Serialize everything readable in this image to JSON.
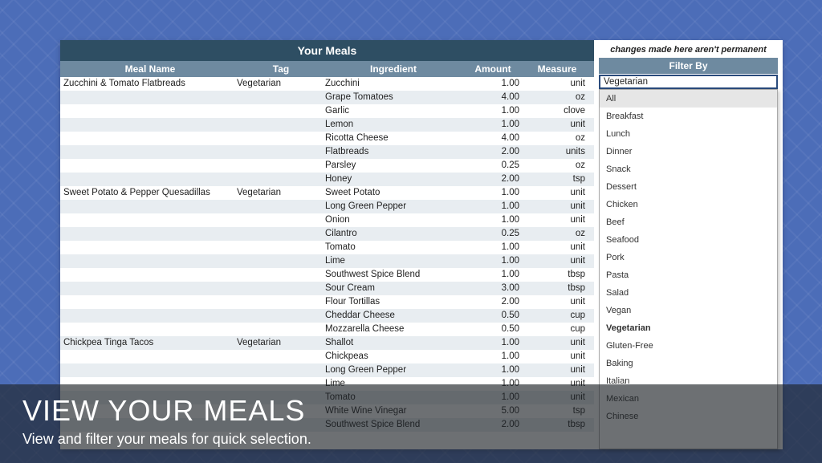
{
  "title": "Your Meals",
  "columns": {
    "meal": "Meal Name",
    "tag": "Tag",
    "ingredient": "Ingredient",
    "amount": "Amount",
    "measure": "Measure"
  },
  "rows": [
    {
      "meal": "Zucchini & Tomato Flatbreads",
      "tag": "Vegetarian",
      "ingredient": "Zucchini",
      "amount": "1.00",
      "measure": "unit"
    },
    {
      "meal": "",
      "tag": "",
      "ingredient": "Grape Tomatoes",
      "amount": "4.00",
      "measure": "oz"
    },
    {
      "meal": "",
      "tag": "",
      "ingredient": "Garlic",
      "amount": "1.00",
      "measure": "clove"
    },
    {
      "meal": "",
      "tag": "",
      "ingredient": "Lemon",
      "amount": "1.00",
      "measure": "unit"
    },
    {
      "meal": "",
      "tag": "",
      "ingredient": "Ricotta Cheese",
      "amount": "4.00",
      "measure": "oz"
    },
    {
      "meal": "",
      "tag": "",
      "ingredient": "Flatbreads",
      "amount": "2.00",
      "measure": "units"
    },
    {
      "meal": "",
      "tag": "",
      "ingredient": "Parsley",
      "amount": "0.25",
      "measure": "oz"
    },
    {
      "meal": "",
      "tag": "",
      "ingredient": "Honey",
      "amount": "2.00",
      "measure": "tsp"
    },
    {
      "meal": "Sweet Potato & Pepper Quesadillas",
      "tag": "Vegetarian",
      "ingredient": "Sweet Potato",
      "amount": "1.00",
      "measure": "unit"
    },
    {
      "meal": "",
      "tag": "",
      "ingredient": "Long Green Pepper",
      "amount": "1.00",
      "measure": "unit"
    },
    {
      "meal": "",
      "tag": "",
      "ingredient": "Onion",
      "amount": "1.00",
      "measure": "unit"
    },
    {
      "meal": "",
      "tag": "",
      "ingredient": "Cilantro",
      "amount": "0.25",
      "measure": "oz"
    },
    {
      "meal": "",
      "tag": "",
      "ingredient": "Tomato",
      "amount": "1.00",
      "measure": "unit"
    },
    {
      "meal": "",
      "tag": "",
      "ingredient": "Lime",
      "amount": "1.00",
      "measure": "unit"
    },
    {
      "meal": "",
      "tag": "",
      "ingredient": "Southwest Spice Blend",
      "amount": "1.00",
      "measure": "tbsp"
    },
    {
      "meal": "",
      "tag": "",
      "ingredient": "Sour Cream",
      "amount": "3.00",
      "measure": "tbsp"
    },
    {
      "meal": "",
      "tag": "",
      "ingredient": "Flour Tortillas",
      "amount": "2.00",
      "measure": "unit"
    },
    {
      "meal": "",
      "tag": "",
      "ingredient": "Cheddar Cheese",
      "amount": "0.50",
      "measure": "cup"
    },
    {
      "meal": "",
      "tag": "",
      "ingredient": "Mozzarella Cheese",
      "amount": "0.50",
      "measure": "cup"
    },
    {
      "meal": "Chickpea Tinga Tacos",
      "tag": "Vegetarian",
      "ingredient": "Shallot",
      "amount": "1.00",
      "measure": "unit"
    },
    {
      "meal": "",
      "tag": "",
      "ingredient": "Chickpeas",
      "amount": "1.00",
      "measure": "unit"
    },
    {
      "meal": "",
      "tag": "",
      "ingredient": "Long Green Pepper",
      "amount": "1.00",
      "measure": "unit"
    },
    {
      "meal": "",
      "tag": "",
      "ingredient": "Lime",
      "amount": "1.00",
      "measure": "unit"
    },
    {
      "meal": "",
      "tag": "",
      "ingredient": "Tomato",
      "amount": "1.00",
      "measure": "unit"
    },
    {
      "meal": "",
      "tag": "",
      "ingredient": "White Wine Vinegar",
      "amount": "5.00",
      "measure": "tsp"
    },
    {
      "meal": "",
      "tag": "",
      "ingredient": "Southwest Spice Blend",
      "amount": "2.00",
      "measure": "tbsp"
    }
  ],
  "side": {
    "note": "changes made here aren't permanent",
    "filter_header": "Filter By",
    "selected": "Vegetarian",
    "options": [
      "All",
      "Breakfast",
      "Lunch",
      "Dinner",
      "Snack",
      "Dessert",
      "Chicken",
      "Beef",
      "Seafood",
      "Pork",
      "Pasta",
      "Salad",
      "Vegan",
      "Vegetarian",
      "Gluten-Free",
      "Baking",
      "Italian",
      "Mexican",
      "Chinese"
    ]
  },
  "caption": {
    "heading": "VIEW YOUR MEALS",
    "sub": "View and filter your meals for quick selection."
  }
}
